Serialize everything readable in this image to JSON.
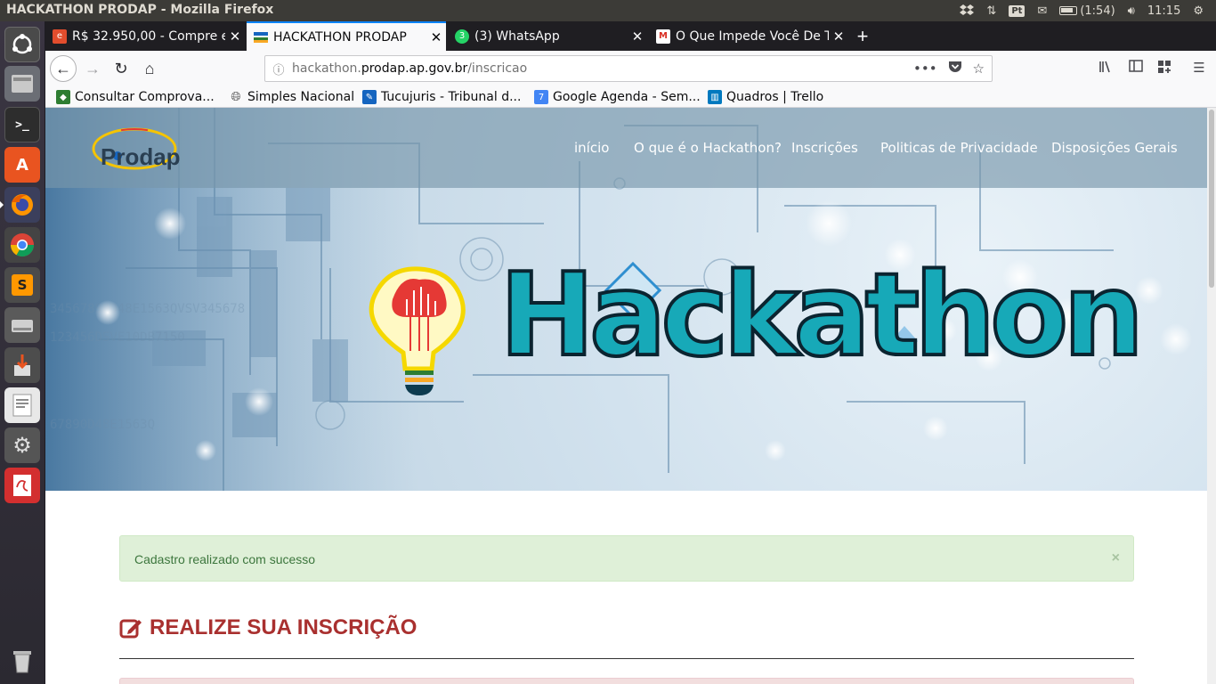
{
  "window_title": "HACKATHON PRODAP - Mozilla Firefox",
  "tray": {
    "keyboard_layout": "Pt",
    "battery": "(1:54)",
    "clock": "11:15"
  },
  "launcher": {
    "items": [
      "dash",
      "files",
      "terminal",
      "software-center",
      "firefox",
      "chrome",
      "sublime-text",
      "drive",
      "installer",
      "text-editor",
      "system-settings",
      "document-viewer",
      "trash"
    ]
  },
  "tabs": [
    {
      "label": "R$ 32.950,00 - Compre e",
      "favicon_color": "#e24d2d"
    },
    {
      "label": "HACKATHON PRODAP",
      "favicon_color": "#1b8a3a"
    },
    {
      "label": "(3) WhatsApp",
      "favicon_color": "#25d366",
      "badge": "3"
    },
    {
      "label": "O Que Impede Você De T",
      "favicon_color": "#d93025"
    }
  ],
  "url": {
    "prefix": "hackathon.",
    "host": "prodap.ap.gov.br",
    "path": "/inscricao"
  },
  "bookmarks": [
    {
      "label": "Consultar Comprova...",
      "icon_color": "#2e7d32"
    },
    {
      "label": "Simples Nacional",
      "icon_color": "#555555"
    },
    {
      "label": "Tucujuris - Tribunal d...",
      "icon_color": "#1565c0"
    },
    {
      "label": "Google Agenda - Sem...",
      "icon_color": "#4285f4",
      "icon_text": "7"
    },
    {
      "label": "Quadros | Trello",
      "icon_color": "#0079bf"
    }
  ],
  "site": {
    "logo_text": "Prodap",
    "nav": [
      "início",
      "O que é o Hackathon?",
      "Inscrições",
      "Politicas de Privacidade",
      "Disposições Gerais"
    ],
    "hero_title": "Hackathon",
    "success_message": "Cadastro realizado com sucesso",
    "close_symbol": "×",
    "section_title": "REALIZE SUA INSCRIÇÃO"
  },
  "colors": {
    "accent_red": "#a9302f",
    "success_bg": "#dff0d8",
    "success_text": "#3c763d",
    "hackathon_teal": "#17a9b8"
  }
}
